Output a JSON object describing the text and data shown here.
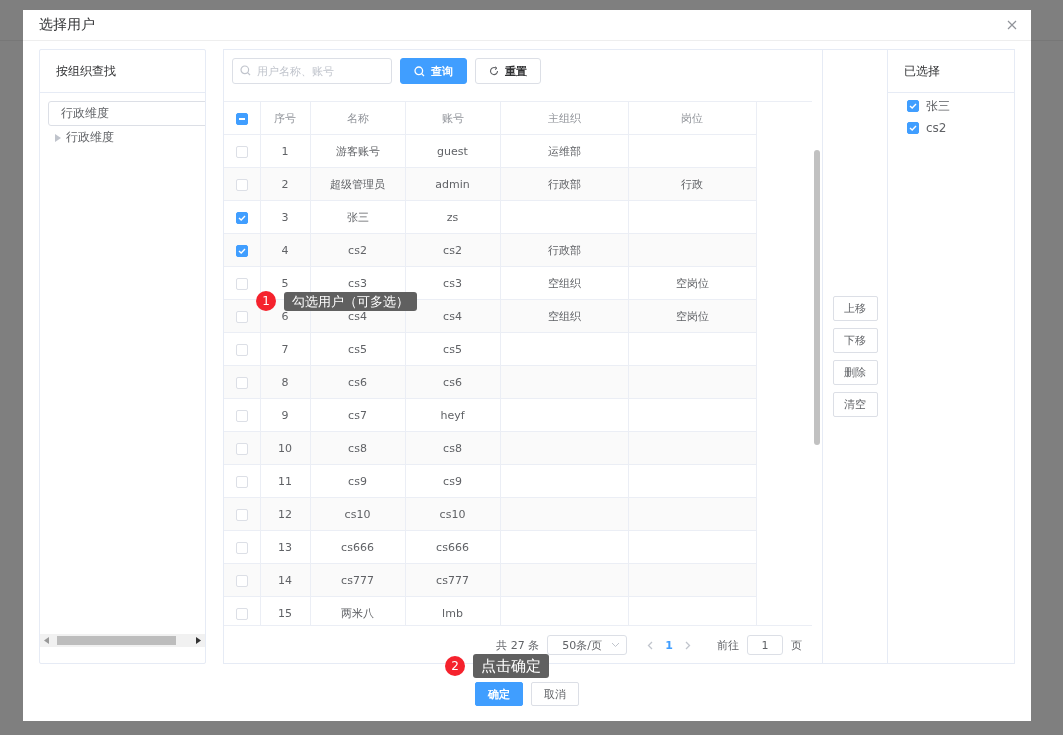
{
  "dialog": {
    "title": "选择用户"
  },
  "org_panel": {
    "title": "按组织查找",
    "filter_value": "行政维度",
    "tree": [
      {
        "label": "行政维度",
        "expanded": false
      }
    ]
  },
  "search": {
    "placeholder": "用户名称、账号",
    "query_button": "查询",
    "reset_button": "重置"
  },
  "table": {
    "select_all": {
      "indeterminate": true
    },
    "columns": [
      "序号",
      "名称",
      "账号",
      "主组织",
      "岗位"
    ],
    "rows": [
      {
        "cells": [
          "1",
          "游客账号",
          "guest",
          "运维部",
          ""
        ],
        "checked": false
      },
      {
        "cells": [
          "2",
          "超级管理员",
          "admin",
          "行政部",
          "行政"
        ],
        "checked": false
      },
      {
        "cells": [
          "3",
          "张三",
          "zs",
          "",
          ""
        ],
        "checked": true
      },
      {
        "cells": [
          "4",
          "cs2",
          "cs2",
          "行政部",
          ""
        ],
        "checked": true
      },
      {
        "cells": [
          "5",
          "cs3",
          "cs3",
          "空组织",
          "空岗位"
        ],
        "checked": false
      },
      {
        "cells": [
          "6",
          "cs4",
          "cs4",
          "空组织",
          "空岗位"
        ],
        "checked": false
      },
      {
        "cells": [
          "7",
          "cs5",
          "cs5",
          "",
          ""
        ],
        "checked": false
      },
      {
        "cells": [
          "8",
          "cs6",
          "cs6",
          "",
          ""
        ],
        "checked": false
      },
      {
        "cells": [
          "9",
          "cs7",
          "heyf",
          "",
          ""
        ],
        "checked": false
      },
      {
        "cells": [
          "10",
          "cs8",
          "cs8",
          "",
          ""
        ],
        "checked": false
      },
      {
        "cells": [
          "11",
          "cs9",
          "cs9",
          "",
          ""
        ],
        "checked": false
      },
      {
        "cells": [
          "12",
          "cs10",
          "cs10",
          "",
          ""
        ],
        "checked": false
      },
      {
        "cells": [
          "13",
          "cs666",
          "cs666",
          "",
          ""
        ],
        "checked": false
      },
      {
        "cells": [
          "14",
          "cs777",
          "cs777",
          "",
          ""
        ],
        "checked": false
      },
      {
        "cells": [
          "15",
          "两米八",
          "lmb",
          "",
          ""
        ],
        "checked": false
      }
    ]
  },
  "pagination": {
    "total": "共 27 条",
    "page_size": "50条/页",
    "pages": [
      {
        "label": "1",
        "selected": true
      }
    ],
    "goto_label": "前往",
    "goto_value": "1",
    "goto_suffix": "页"
  },
  "move_buttons": [
    "上移",
    "下移",
    "删除",
    "清空"
  ],
  "selected_panel": {
    "title": "已选择",
    "items": [
      {
        "label": "张三",
        "checked": true
      },
      {
        "label": "cs2",
        "checked": true
      }
    ]
  },
  "footer": {
    "confirm": "确定",
    "cancel": "取消"
  },
  "callouts": [
    {
      "number": "1",
      "text": "勾选用户（可多选）"
    },
    {
      "number": "2",
      "text": "点击确定"
    }
  ]
}
